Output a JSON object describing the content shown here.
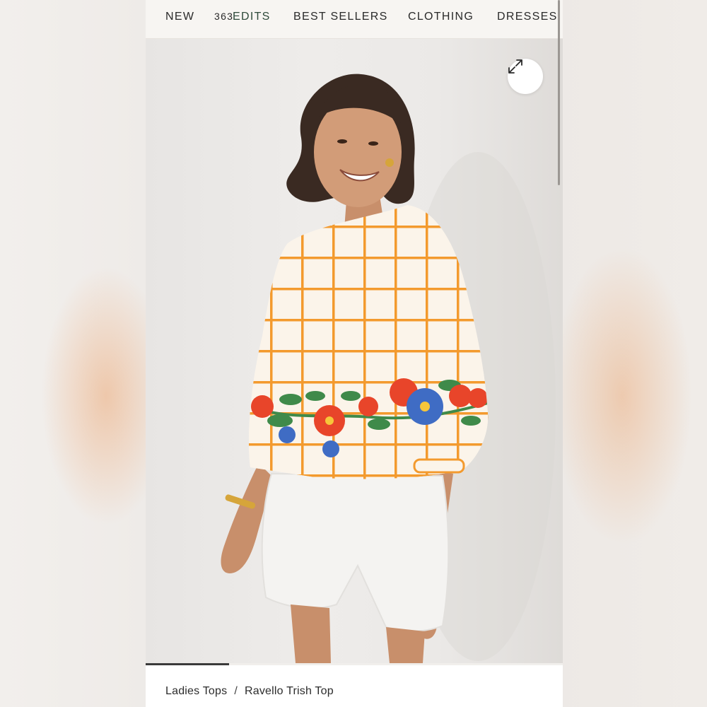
{
  "nav": {
    "items": [
      {
        "label": "NEW",
        "badge": "363"
      },
      {
        "label": "EDITS"
      },
      {
        "label": "BEST SELLERS"
      },
      {
        "label": "CLOTHING"
      },
      {
        "label": "DRESSES"
      }
    ]
  },
  "gallery": {
    "expand_icon": "expand-arrows-icon",
    "progress": 0.2
  },
  "breadcrumb": {
    "category": "Ladies Tops",
    "separator": "/",
    "product": "Ravello Trish Top"
  },
  "colors": {
    "nav_background": "#f7f5f2",
    "nav_accent": "#2e4a3a",
    "top_orange": "#f39a2e",
    "flower_red": "#e8452a",
    "flower_blue": "#3f6cc4",
    "leaf_green": "#3f8a4a"
  }
}
